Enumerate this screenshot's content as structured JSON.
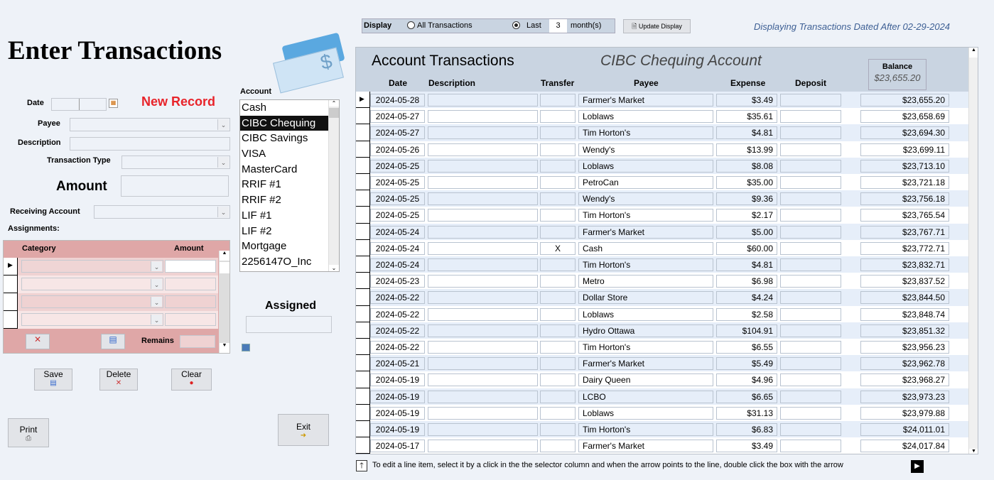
{
  "form": {
    "title": "Enter Transactions",
    "status": "New Record",
    "date_label": "Date",
    "payee_label": "Payee",
    "description_label": "Description",
    "type_label": "Transaction Type",
    "amount_label": "Amount",
    "receiving_label": "Receiving Account",
    "assignments_label": "Assignments:",
    "category_header": "Category",
    "amount_header": "Amount",
    "remains_label": "Remains",
    "assigned_label": "Assigned",
    "account_label": "Account"
  },
  "accounts": [
    "Cash",
    "CIBC Chequing",
    "CIBC Savings",
    "VISA",
    "MasterCard",
    "RRIF #1",
    "RRIF #2",
    "LIF #1",
    "LIF #2",
    "Mortgage",
    "2256147O_Inc"
  ],
  "selected_account": "CIBC Chequing",
  "buttons": {
    "save": "Save",
    "delete": "Delete",
    "clear": "Clear",
    "print": "Print",
    "exit": "Exit",
    "update": "Update Display"
  },
  "display": {
    "label": "Display",
    "all": "All Transactions",
    "last": "Last",
    "months": "3",
    "months_label": "month(s)",
    "selected": "last",
    "info": "Displaying Transactions Dated After 02-29-2024"
  },
  "grid": {
    "title": "Account Transactions",
    "account": "CIBC Chequing Account",
    "balance_label": "Balance",
    "balance": "$23,655.20",
    "headers": {
      "date": "Date",
      "description": "Description",
      "transfer": "Transfer",
      "payee": "Payee",
      "expense": "Expense",
      "deposit": "Deposit"
    },
    "rows": [
      {
        "date": "2024-05-28",
        "transfer": "",
        "payee": "Farmer's Market",
        "expense": "$3.49",
        "balance": "$23,655.20"
      },
      {
        "date": "2024-05-27",
        "transfer": "",
        "payee": "Loblaws",
        "expense": "$35.61",
        "balance": "$23,658.69"
      },
      {
        "date": "2024-05-27",
        "transfer": "",
        "payee": "Tim Horton's",
        "expense": "$4.81",
        "balance": "$23,694.30"
      },
      {
        "date": "2024-05-26",
        "transfer": "",
        "payee": "Wendy's",
        "expense": "$13.99",
        "balance": "$23,699.11"
      },
      {
        "date": "2024-05-25",
        "transfer": "",
        "payee": "Loblaws",
        "expense": "$8.08",
        "balance": "$23,713.10"
      },
      {
        "date": "2024-05-25",
        "transfer": "",
        "payee": "PetroCan",
        "expense": "$35.00",
        "balance": "$23,721.18"
      },
      {
        "date": "2024-05-25",
        "transfer": "",
        "payee": "Wendy's",
        "expense": "$9.36",
        "balance": "$23,756.18"
      },
      {
        "date": "2024-05-25",
        "transfer": "",
        "payee": "Tim Horton's",
        "expense": "$2.17",
        "balance": "$23,765.54"
      },
      {
        "date": "2024-05-24",
        "transfer": "",
        "payee": "Farmer's Market",
        "expense": "$5.00",
        "balance": "$23,767.71"
      },
      {
        "date": "2024-05-24",
        "transfer": "X",
        "payee": "Cash",
        "expense": "$60.00",
        "balance": "$23,772.71"
      },
      {
        "date": "2024-05-24",
        "transfer": "",
        "payee": "Tim Horton's",
        "expense": "$4.81",
        "balance": "$23,832.71"
      },
      {
        "date": "2024-05-23",
        "transfer": "",
        "payee": "Metro",
        "expense": "$6.98",
        "balance": "$23,837.52"
      },
      {
        "date": "2024-05-22",
        "transfer": "",
        "payee": "Dollar Store",
        "expense": "$4.24",
        "balance": "$23,844.50"
      },
      {
        "date": "2024-05-22",
        "transfer": "",
        "payee": "Loblaws",
        "expense": "$2.58",
        "balance": "$23,848.74"
      },
      {
        "date": "2024-05-22",
        "transfer": "",
        "payee": "Hydro Ottawa",
        "expense": "$104.91",
        "balance": "$23,851.32"
      },
      {
        "date": "2024-05-22",
        "transfer": "",
        "payee": "Tim Horton's",
        "expense": "$6.55",
        "balance": "$23,956.23"
      },
      {
        "date": "2024-05-21",
        "transfer": "",
        "payee": "Farmer's Market",
        "expense": "$5.49",
        "balance": "$23,962.78"
      },
      {
        "date": "2024-05-19",
        "transfer": "",
        "payee": "Dairy Queen",
        "expense": "$4.96",
        "balance": "$23,968.27"
      },
      {
        "date": "2024-05-19",
        "transfer": "",
        "payee": "LCBO",
        "expense": "$6.65",
        "balance": "$23,973.23"
      },
      {
        "date": "2024-05-19",
        "transfer": "",
        "payee": "Loblaws",
        "expense": "$31.13",
        "balance": "$23,979.88"
      },
      {
        "date": "2024-05-19",
        "transfer": "",
        "payee": "Tim Horton's",
        "expense": "$6.83",
        "balance": "$24,011.01"
      },
      {
        "date": "2024-05-17",
        "transfer": "",
        "payee": "Farmer's Market",
        "expense": "$3.49",
        "balance": "$24,017.84"
      }
    ]
  },
  "footer": {
    "hint": "To edit a line item, select it by a click in the the selector column and when the arrow points to the line, double click the box with the arrow"
  }
}
